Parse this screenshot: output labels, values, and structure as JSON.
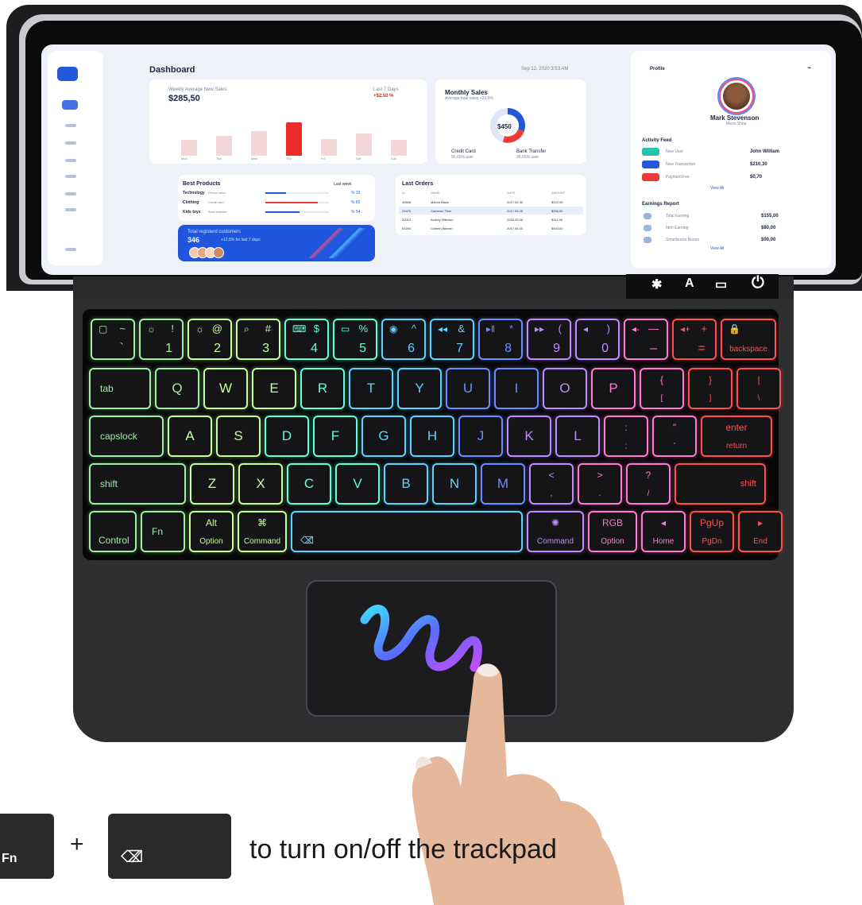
{
  "dashboard": {
    "title": "Dashboard",
    "date": "Sep 12, 2020 3:53 AM",
    "weekly": {
      "label": "Weekly Average New Sales",
      "value": "$285,50",
      "period": "Last 7 Days",
      "change": "+$2,50 %"
    },
    "days": [
      "Mon",
      "Tue",
      "Wed",
      "Thu",
      "Fri",
      "Sat",
      "Sun"
    ],
    "bars": [
      0.35,
      0.45,
      0.55,
      0.75,
      0.38,
      0.5,
      0.36
    ],
    "monthly": {
      "title": "Monthly Sales",
      "subtitle": "Average total sales +23,5%",
      "center": "$450",
      "legend": [
        {
          "label": "Credit Card",
          "sub": "55,65% user"
        },
        {
          "label": "Bank Transfer",
          "sub": "35,65% user"
        }
      ]
    },
    "best_products": {
      "title": "Best Products",
      "filter": "Last week",
      "rows": [
        {
          "name": "Technology",
          "sub": "Phone sales",
          "pct": "% 33",
          "fill": 0.33
        },
        {
          "name": "Clothing",
          "sub": "Credit card",
          "pct": "% 82",
          "fill": 0.82
        },
        {
          "name": "Kids toys",
          "sub": "Bank transfer",
          "pct": "% 54",
          "fill": 0.54
        }
      ]
    },
    "orders": {
      "title": "Last Orders",
      "headers": [
        "ID",
        "NAME",
        "DATE",
        "AMOUNT"
      ],
      "rows": [
        {
          "id": "49508",
          "name": "Marvin Black",
          "date": "2017.02.30",
          "amount": "$120,00"
        },
        {
          "id": "29475",
          "name": "Cameron Tims",
          "date": "2017.03.25",
          "amount": "$256,50"
        },
        {
          "id": "20012",
          "name": "Audrey Hillerton",
          "date": "2016.03.06",
          "amount": "$112,00"
        },
        {
          "id": "63254",
          "name": "Colleen Warren",
          "date": "2017.04.03",
          "amount": "$453,00"
        }
      ]
    },
    "customers": {
      "label": "Total registerd customers",
      "value": "346",
      "change": "+12,5% for last 7 days"
    },
    "profile": {
      "title": "Profile",
      "name": "Mark Stevenson",
      "company": "Meno Shop",
      "feed_title": "Activity Feed",
      "feed": [
        {
          "label": "New User",
          "value": "John William"
        },
        {
          "label": "New Transaction",
          "value": "$210,30"
        },
        {
          "label": "Payment Fee",
          "value": "$0,70"
        }
      ],
      "view_all": "View All",
      "earnings_title": "Earnings Report",
      "earnings": [
        {
          "label": "Total Earning",
          "value": "$155,00"
        },
        {
          "label": "Item Earning",
          "value": "$80,00"
        },
        {
          "label": "Smartbucks Bonus",
          "value": "$00,00"
        }
      ]
    }
  },
  "hinge_icons": [
    "✱",
    "A",
    "▭",
    "⏻"
  ],
  "keys": {
    "r1": [
      {
        "tl": "▢",
        "tr": "~",
        "br": "`"
      },
      {
        "tl": "☼",
        "tr": "!",
        "br": "1"
      },
      {
        "tl": "☼",
        "tr": "@",
        "br": "2"
      },
      {
        "tl": "⌕",
        "tr": "#",
        "br": "3"
      },
      {
        "tl": "⌨",
        "tr": "$",
        "br": "4"
      },
      {
        "tl": "▭",
        "tr": "%",
        "br": "5"
      },
      {
        "tl": "◉",
        "tr": "^",
        "br": "6"
      },
      {
        "tl": "◂◂",
        "tr": "&",
        "br": "7"
      },
      {
        "tl": "▸‖",
        "tr": "*",
        "br": "8"
      },
      {
        "tl": "▸▸",
        "tr": "(",
        "br": "9"
      },
      {
        "tl": "◂",
        "tr": ")",
        "br": "0"
      },
      {
        "tl": "◂-",
        "tr": "—",
        "br": "–"
      },
      {
        "tl": "◂+",
        "tr": "+",
        "br": "="
      },
      {
        "tl": "🔒",
        "bc": "backspace"
      }
    ],
    "r2": [
      "tab",
      "Q",
      "W",
      "E",
      "R",
      "T",
      "Y",
      "U",
      "I",
      "O",
      "P",
      "{ [",
      "} ]",
      "| \\"
    ],
    "r3": [
      "capslock",
      "A",
      "S",
      "D",
      "F",
      "G",
      "H",
      "J",
      "K",
      "L",
      ": ;",
      "\" '",
      "enter return"
    ],
    "r4": [
      "shift",
      "Z",
      "X",
      "C",
      "V",
      "B",
      "N",
      "M",
      "< ,",
      "> .",
      "? /",
      "shift"
    ],
    "r5": [
      {
        "bl": "Control"
      },
      {
        "ml": "Fn"
      },
      {
        "tc": "Alt",
        "bc": "Option"
      },
      {
        "tc": "⌘",
        "bc": "Command"
      },
      {
        "bl": "⌫̸"
      },
      {
        "tc": "✺",
        "bc": "Command"
      },
      {
        "tc": "RGB",
        "bc": "Option"
      },
      {
        "tc": "◂",
        "bc": "Home"
      },
      {
        "tc": "PgUp",
        "bc": "PgDn"
      },
      {
        "tc": "▸",
        "bc": "End"
      }
    ]
  },
  "legend": {
    "fn_label": "Fn",
    "plus": "+",
    "toggle_icon": "trackpad-toggle-icon",
    "caption": "to turn on/off the trackpad"
  }
}
